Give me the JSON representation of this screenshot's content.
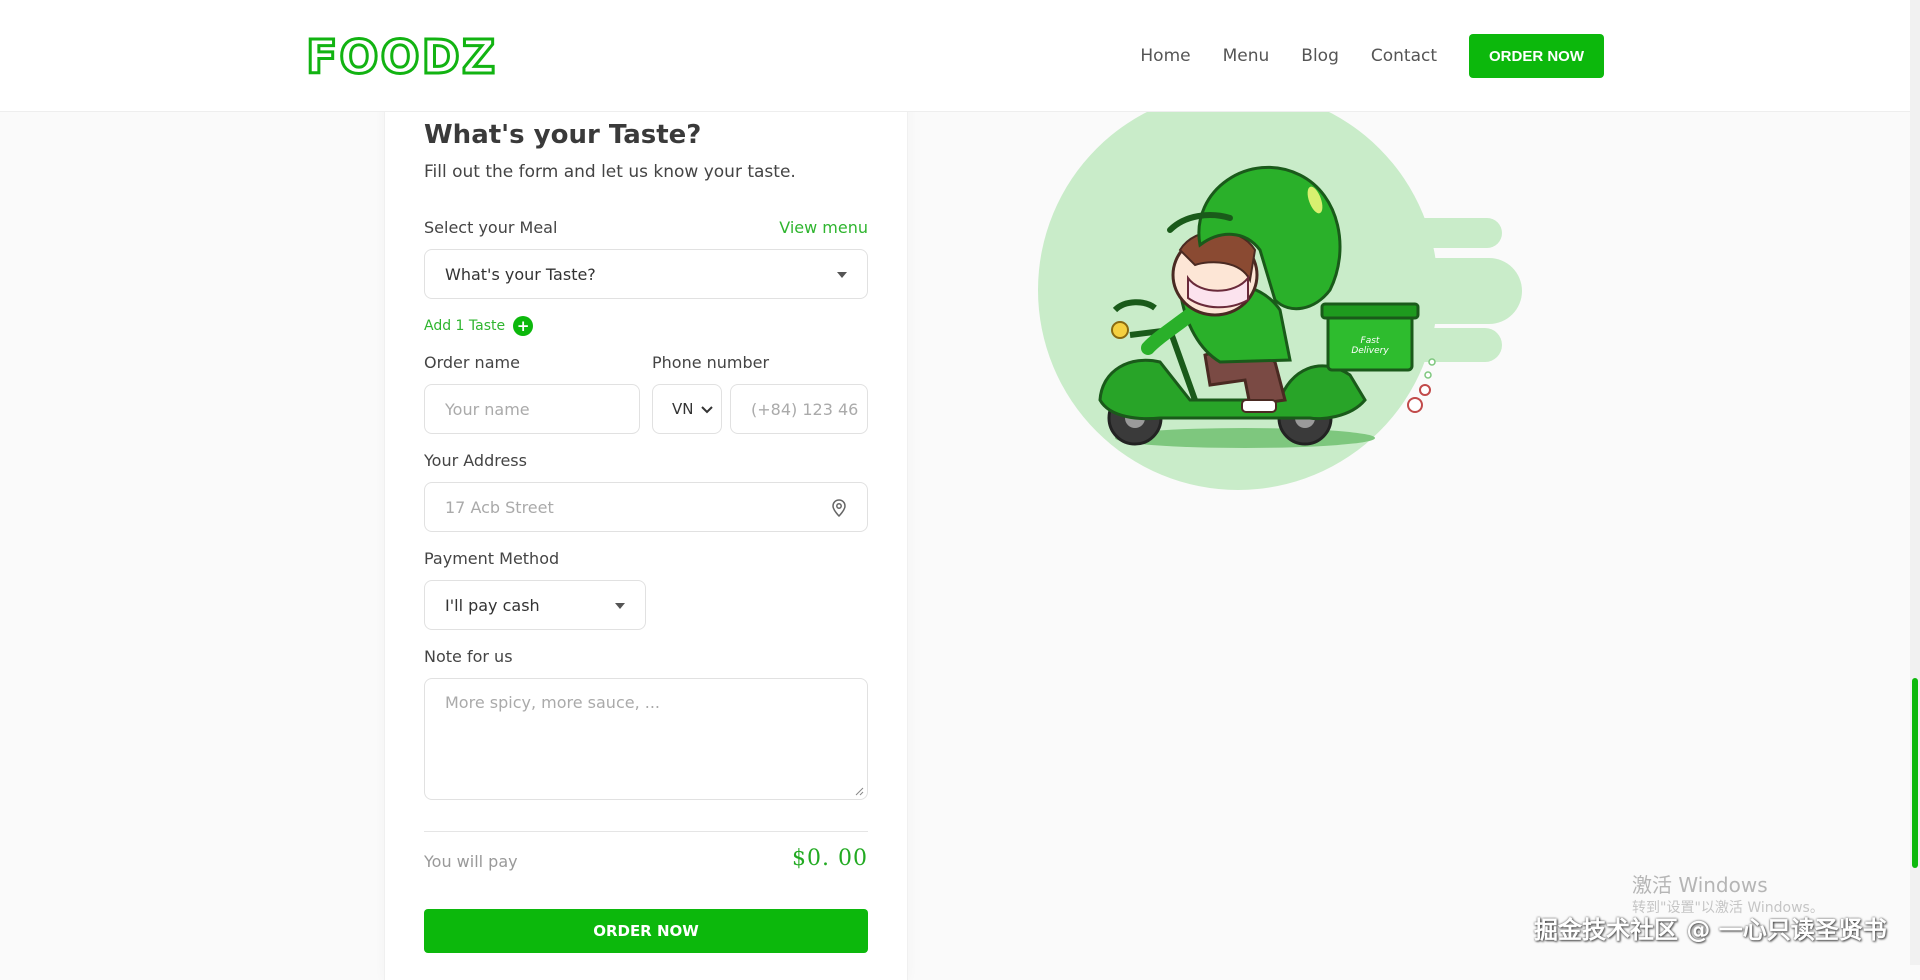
{
  "header": {
    "logo": "FOODZ",
    "nav": [
      "Home",
      "Menu",
      "Blog",
      "Contact"
    ],
    "order_btn": "ORDER NOW"
  },
  "form": {
    "title": "What's your Taste?",
    "subtitle": "Fill out the form and let us know your taste.",
    "meal": {
      "label": "Select your Meal",
      "view_menu": "View menu",
      "value": "What's your Taste?"
    },
    "add_taste": "Add 1 Taste",
    "order_name": {
      "label": "Order name",
      "placeholder": "Your name"
    },
    "phone": {
      "label": "Phone number",
      "country": "VN",
      "placeholder": "(+84) 123 46"
    },
    "address": {
      "label": "Your Address",
      "placeholder": "17 Acb Street"
    },
    "payment": {
      "label": "Payment Method",
      "value": "I'll pay cash"
    },
    "note": {
      "label": "Note for us",
      "placeholder": "More spicy, more sauce, ..."
    },
    "total": {
      "label": "You will pay",
      "amount": "$0. 00"
    },
    "submit": "ORDER NOW"
  },
  "illustration": {
    "box_text_1": "Fast",
    "box_text_2": "Delivery"
  },
  "watermark": {
    "activate": "激活 Windows",
    "activate_sub": "转到\"设置\"以激活 Windows。",
    "community": "掘金技术社区 @ 一心只读圣贤书"
  },
  "colors": {
    "brand_green": "#0cb80c",
    "link_green": "#2fb52f",
    "illustration_bg": "#c9ecc9"
  }
}
